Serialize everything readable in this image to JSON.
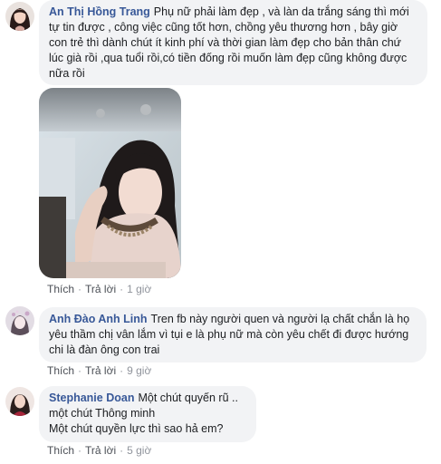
{
  "comments": [
    {
      "author": "An Thị Hồng Trang",
      "text": "Phụ nữ phải làm đẹp , và làn da trắng sáng thì mới tự tin được , công việc cũng tốt hơn, chồng yêu thương hơn , bây giờ con trẻ thì dành chút ít kinh phí và thời gian làm đẹp cho bản thân chứ lúc già rồi ,qua tuổi rồi,có tiền đống rồi muốn làm đẹp cũng không được nữa rồi",
      "like": "Thích",
      "reply": "Trả lời",
      "time": "1 giờ"
    },
    {
      "author": "Anh Đào Anh Linh",
      "text": "Tren fb này người quen và người lạ chất chắn là họ yêu thầm chị vân lắm vì tụi e là phụ nữ mà còn yêu chết đi được hướng chi là đàn ông con trai",
      "like": "Thích",
      "reply": "Trả lời",
      "time": "9 giờ"
    },
    {
      "author": "Stephanie Doan",
      "text": "Một chút quyến rũ ..\nmột chút Thông minh\nMột chút quyền lực thì sao hả em?",
      "like": "Thích",
      "reply": "Trả lời",
      "time": "5 giờ"
    }
  ],
  "colors": {
    "author_link": "#385898",
    "bubble_bg": "#f2f3f5",
    "meta_text": "#90949c"
  }
}
